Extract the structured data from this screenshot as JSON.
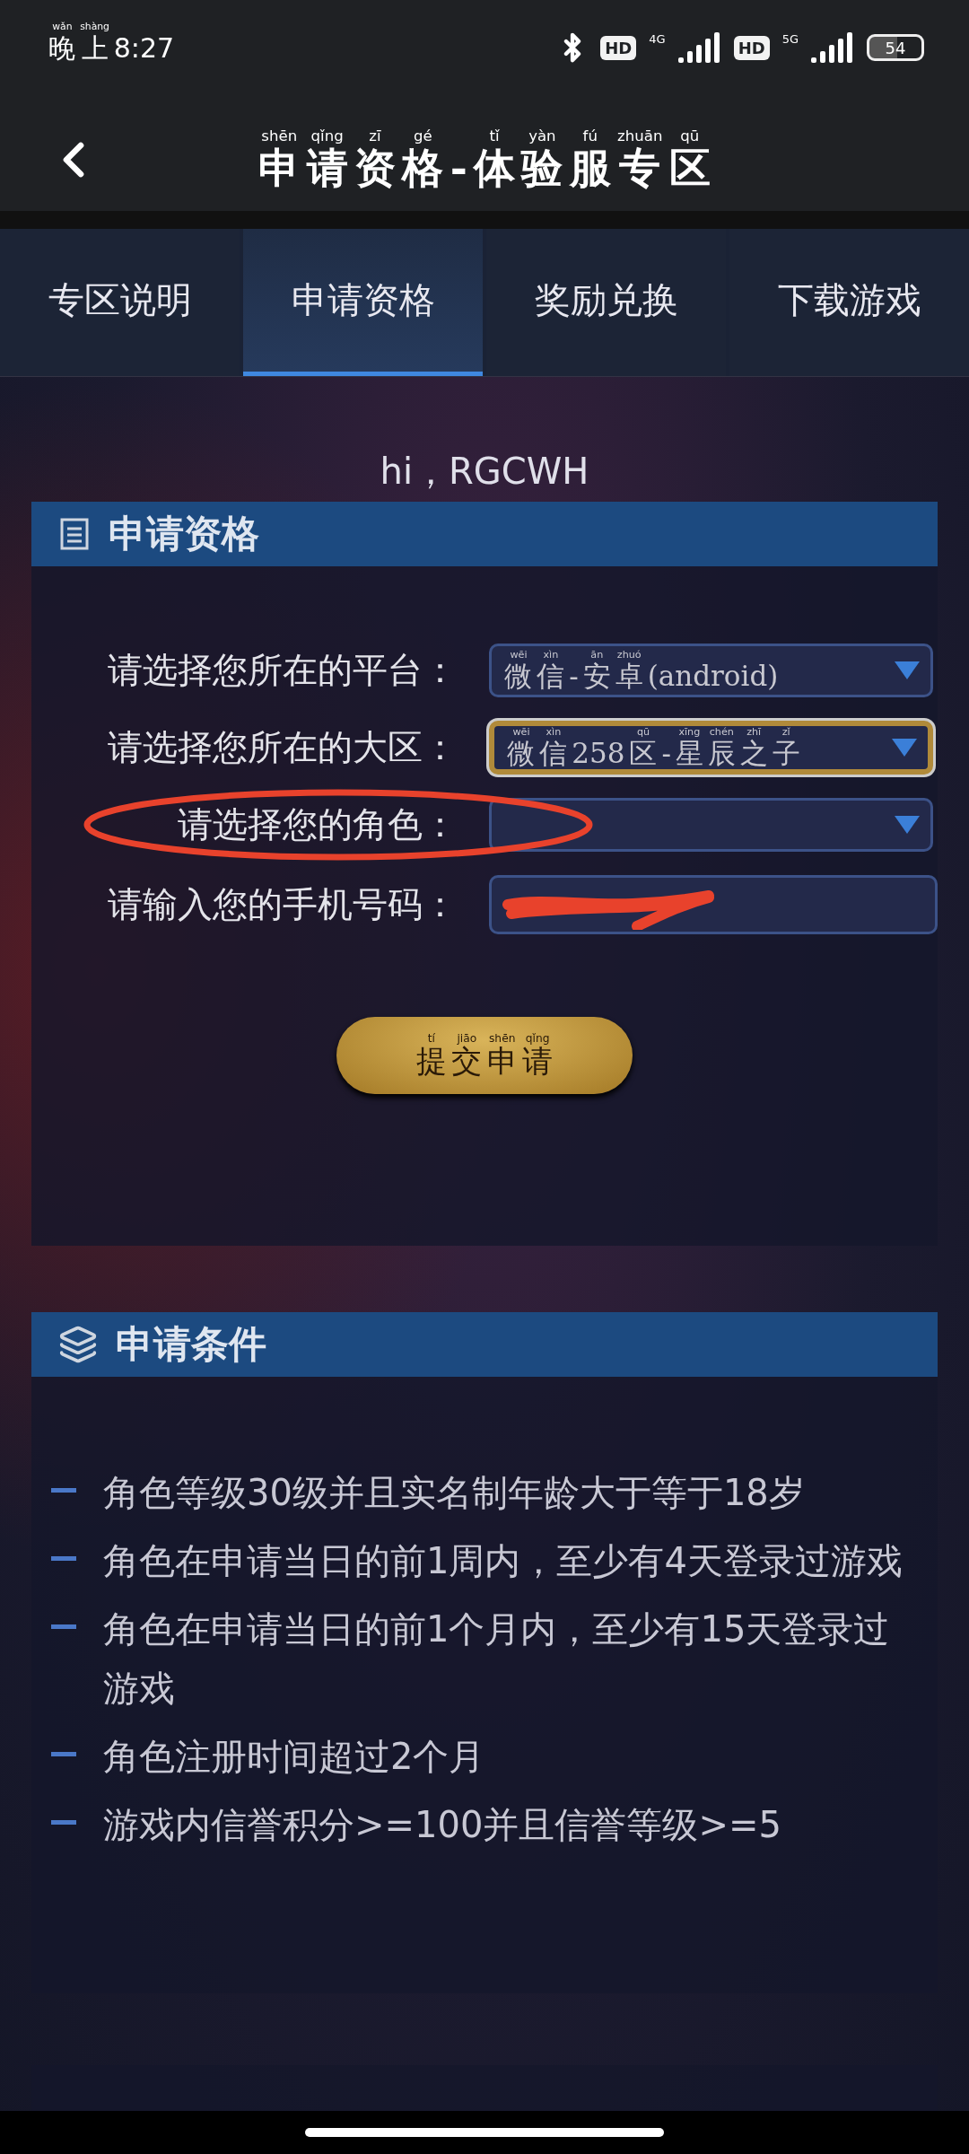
{
  "status_bar": {
    "time": [
      {
        "t": "晚",
        "py": "wǎn"
      },
      {
        "t": "上",
        "py": "shàng"
      },
      {
        "t": "8:27"
      }
    ],
    "sim1": {
      "badge": "HD",
      "network": "4G"
    },
    "sim2": {
      "badge": "HD",
      "network": "5G"
    },
    "battery": "54"
  },
  "header": {
    "title": [
      {
        "t": "申",
        "py": "shēn"
      },
      {
        "t": "请",
        "py": "qǐng"
      },
      {
        "t": "资",
        "py": "zī"
      },
      {
        "t": "格",
        "py": "gé"
      },
      {
        "t": "-"
      },
      {
        "t": "体",
        "py": "tǐ"
      },
      {
        "t": "验",
        "py": "yàn"
      },
      {
        "t": "服",
        "py": "fú"
      },
      {
        "t": "专",
        "py": "zhuān"
      },
      {
        "t": "区",
        "py": "qū"
      }
    ]
  },
  "tabs": [
    {
      "label": "专区说明",
      "selected": false
    },
    {
      "label": "申请资格",
      "selected": true
    },
    {
      "label": "奖励兑换",
      "selected": false
    },
    {
      "label": "下载游戏",
      "selected": false
    }
  ],
  "greeting": "hi，RGCWH",
  "apply_panel": {
    "title": "申请资格",
    "fields": [
      {
        "kind": "select",
        "label": "请选择您所在的平台：",
        "value": [
          {
            "t": "微",
            "py": "wēi"
          },
          {
            "t": "信",
            "py": "xìn"
          },
          {
            "t": "-"
          },
          {
            "t": "安",
            "py": "ān"
          },
          {
            "t": "卓",
            "py": "zhuó"
          },
          {
            "t": "(android)"
          }
        ],
        "focused": false,
        "circled": false
      },
      {
        "kind": "select",
        "label": "请选择您所在的大区：",
        "value": [
          {
            "t": "微",
            "py": "wēi"
          },
          {
            "t": "信",
            "py": "xìn"
          },
          {
            "t": "258"
          },
          {
            "t": "区",
            "py": "qū"
          },
          {
            "t": "-"
          },
          {
            "t": "星",
            "py": "xīng"
          },
          {
            "t": "辰",
            "py": "chén"
          },
          {
            "t": "之",
            "py": "zhī"
          },
          {
            "t": "子",
            "py": "zǐ"
          }
        ],
        "focused": true,
        "circled": false
      },
      {
        "kind": "select",
        "label": "请选择您的角色：",
        "focused": false,
        "circled": true
      },
      {
        "kind": "input",
        "label": "请输入您的手机号码：",
        "redacted": true,
        "focused": false,
        "circled": false
      }
    ],
    "submit": [
      {
        "t": "提",
        "py": "tí"
      },
      {
        "t": "交",
        "py": "jiāo"
      },
      {
        "t": "申",
        "py": "shēn"
      },
      {
        "t": "请",
        "py": "qǐng"
      }
    ]
  },
  "conditions_panel": {
    "title": "申请条件",
    "items": [
      "角色等级30级并且实名制年龄大于等于18岁",
      "角色在申请当日的前1周内，至少有4天登录过游戏",
      "角色在申请当日的前1个月内，至少有15天登录过游戏",
      "角色注册时间超过2个月",
      "游戏内信誉积分>=100并且信誉等级>=5"
    ]
  }
}
